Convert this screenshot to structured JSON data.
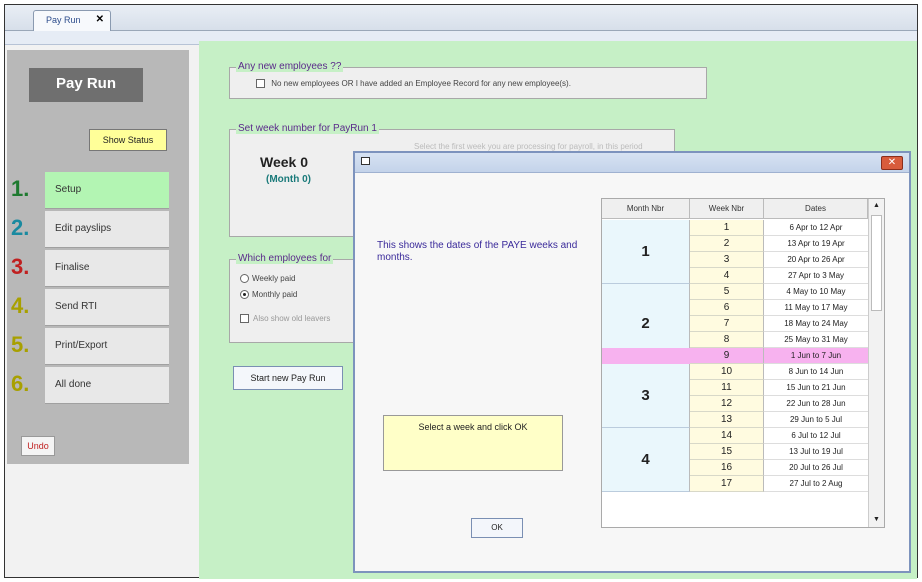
{
  "tab": {
    "label": "Pay Run",
    "close": "✕"
  },
  "sidebar": {
    "title": "Pay Run",
    "show_status": "Show Status",
    "steps": [
      {
        "num": "1.",
        "label": "Setup",
        "color": "#1f7a30"
      },
      {
        "num": "2.",
        "label": "Edit payslips",
        "color": "#1a8aa0"
      },
      {
        "num": "3.",
        "label": "Finalise",
        "color": "#c02020"
      },
      {
        "num": "4.",
        "label": "Send RTI",
        "color": "#a8a000"
      },
      {
        "num": "5.",
        "label": "Print/Export",
        "color": "#a8a000"
      },
      {
        "num": "6.",
        "label": "All done",
        "color": "#a8a000"
      }
    ],
    "undo": "Undo"
  },
  "main": {
    "new_employees": {
      "legend": "Any new employees ??",
      "checkbox_text": "No new employees  OR  I have added an Employee Record for any new employee(s)."
    },
    "week_group": {
      "legend": "Set week number for PayRun 1",
      "hidden_hint": "Select the first week you are processing for payroll, in this period",
      "week": "Week 0",
      "month": "(Month 0)"
    },
    "which_group": {
      "legend": "Which employees for",
      "weekly": "Weekly paid",
      "monthly": "Monthly paid",
      "also_show": "Also show old leavers"
    },
    "start_button": "Start new Pay Run"
  },
  "dialog": {
    "close": "✕",
    "info_text": "This shows the dates of the PAYE weeks and months.",
    "prompt": "Select a week and click OK",
    "ok": "OK",
    "headers": [
      "Month Nbr",
      "Week Nbr",
      "Dates"
    ],
    "months": [
      {
        "month": "1",
        "weeks": [
          {
            "week": "1",
            "dates": "6 Apr  to 12 Apr"
          },
          {
            "week": "2",
            "dates": "13 Apr  to 19 Apr"
          },
          {
            "week": "3",
            "dates": "20 Apr  to 26 Apr"
          },
          {
            "week": "4",
            "dates": "27 Apr  to  3 May"
          }
        ]
      },
      {
        "month": "2",
        "weeks": [
          {
            "week": "5",
            "dates": "4 May  to 10 May"
          },
          {
            "week": "6",
            "dates": "11 May  to 17 May"
          },
          {
            "week": "7",
            "dates": "18 May  to 24 May"
          },
          {
            "week": "8",
            "dates": "25 May  to 31 May"
          },
          {
            "week": "9",
            "dates": "1 Jun  to  7 Jun"
          }
        ]
      },
      {
        "month": "3",
        "weeks": [
          {
            "week": "10",
            "dates": "8 Jun  to 14 Jun"
          },
          {
            "week": "11",
            "dates": "15 Jun  to 21 Jun"
          },
          {
            "week": "12",
            "dates": "22 Jun  to 28 Jun"
          },
          {
            "week": "13",
            "dates": "29 Jun  to  5 Jul"
          }
        ]
      },
      {
        "month": "4",
        "weeks": [
          {
            "week": "14",
            "dates": "6 Jul  to 12 Jul"
          },
          {
            "week": "15",
            "dates": "13 Jul  to 19 Jul"
          },
          {
            "week": "16",
            "dates": "20 Jul  to 26 Jul"
          },
          {
            "week": "17",
            "dates": "27 Jul  to  2 Aug"
          }
        ]
      }
    ],
    "selected_week": "9",
    "scroll_up": "▲",
    "scroll_down": "▼"
  }
}
